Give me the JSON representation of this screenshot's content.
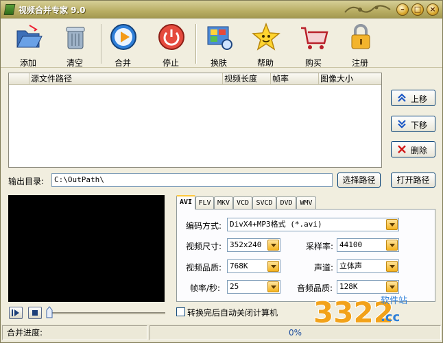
{
  "window": {
    "title": "视频合并专家 9.0"
  },
  "toolbar": {
    "add": "添加",
    "clear": "清空",
    "merge": "合并",
    "stop": "停止",
    "skin": "换肤",
    "help": "帮助",
    "buy": "购买",
    "register": "注册"
  },
  "filelist": {
    "columns": [
      "源文件路径",
      "视频长度",
      "帧率",
      "图像大小"
    ]
  },
  "side_buttons": {
    "up": "上移",
    "down": "下移",
    "delete": "删除"
  },
  "output": {
    "label": "输出目录:",
    "path": "C:\\OutPath\\",
    "choose_label": "选择路径",
    "open_label": "打开路径"
  },
  "tabs": [
    "AVI",
    "FLV",
    "MKV",
    "VCD",
    "SVCD",
    "DVD",
    "WMV"
  ],
  "settings": {
    "codec_label": "编码方式:",
    "codec_value": "DivX4+MP3格式 (*.avi)",
    "size_label": "视频尺寸:",
    "size_value": "352x240",
    "samplerate_label": "采样率:",
    "samplerate_value": "44100",
    "quality_label": "视频品质:",
    "quality_value": "768K",
    "channel_label": "声道:",
    "channel_value": "立体声",
    "fps_label": "帧率/秒:",
    "fps_value": "25",
    "audio_quality_label": "音频品质:",
    "audio_quality_value": "128K"
  },
  "shutdown": {
    "label": "转换完后自动关闭计算机",
    "checked": false
  },
  "status": {
    "label": "合并进度:",
    "progress_text": "0%",
    "progress": 0
  },
  "watermark": {
    "number": "3322",
    "site": "软件站",
    "tld": ".cc"
  }
}
